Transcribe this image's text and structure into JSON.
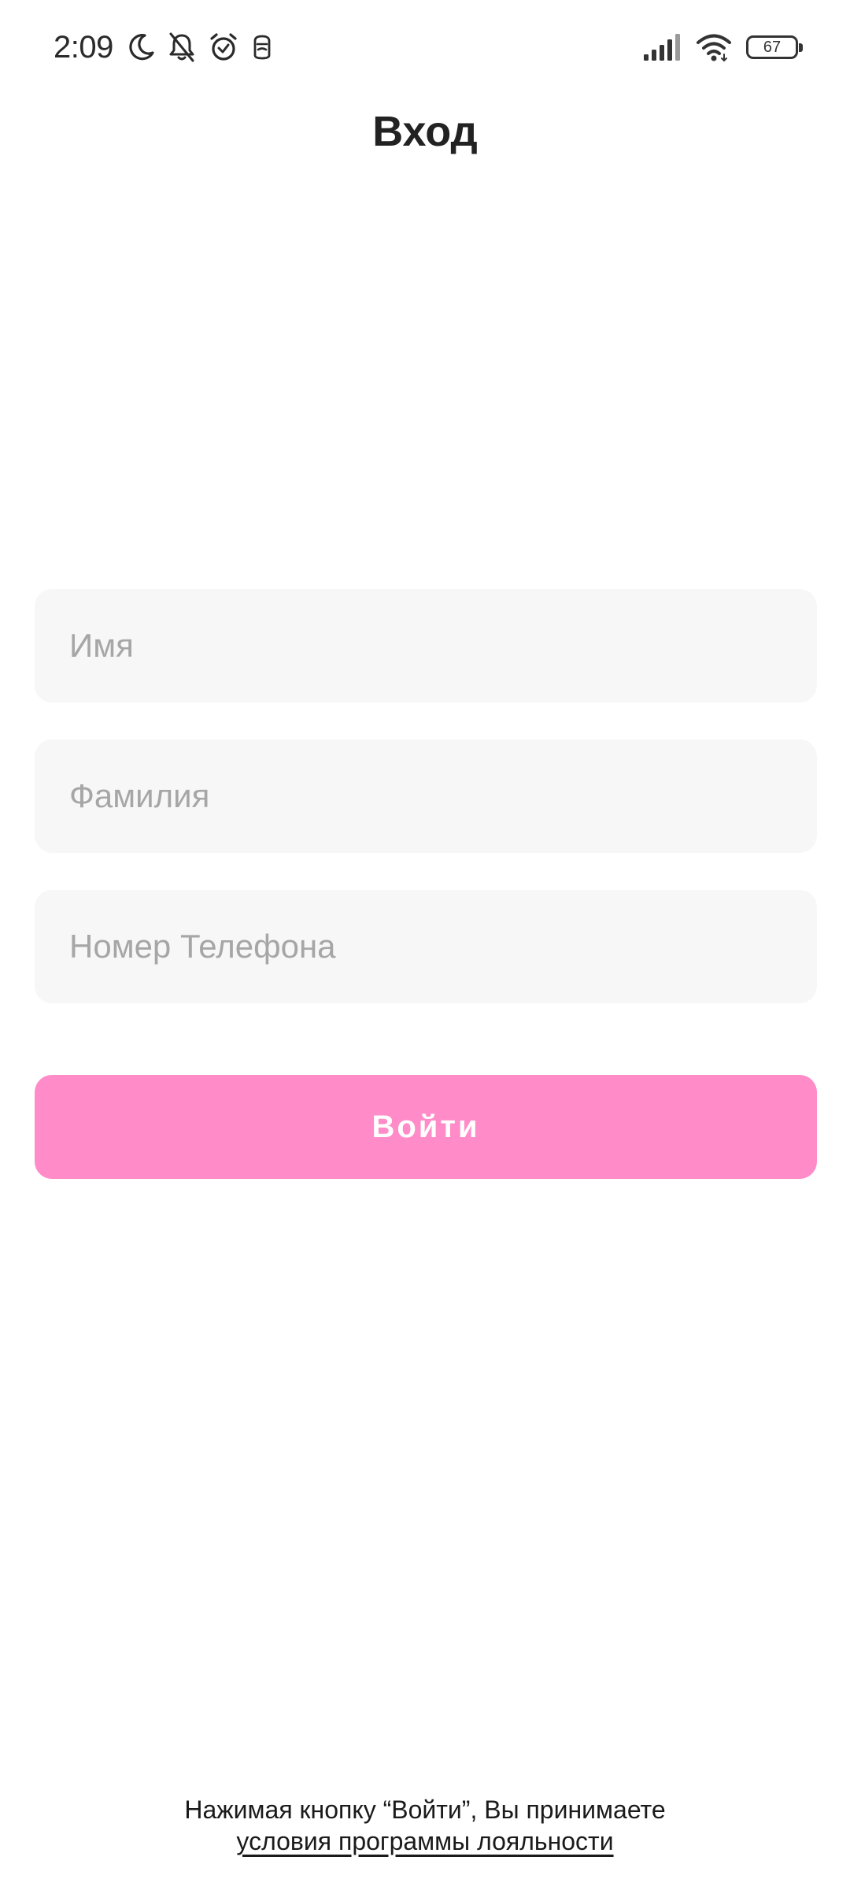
{
  "status_bar": {
    "time": "2:09",
    "icons_left": [
      "moon-icon",
      "bell-off-icon",
      "alarm-icon",
      "app-notification-icon"
    ],
    "icons_right": [
      "signal-icon",
      "wifi-icon",
      "battery-icon"
    ],
    "battery_level": "67"
  },
  "header": {
    "title": "Вход"
  },
  "form": {
    "first_name_placeholder": "Имя",
    "last_name_placeholder": "Фамилия",
    "phone_placeholder": "Номер Телефона",
    "first_name_value": "",
    "last_name_value": "",
    "phone_value": "",
    "submit_label": "Войти"
  },
  "footer": {
    "consent_text": "Нажимая кнопку “Войти”, Вы принимаете",
    "terms_link": "условия программы лояльности"
  },
  "colors": {
    "accent": "#ff8cc9",
    "field_background": "#f7f7f7",
    "placeholder": "#a6a6a6",
    "title": "#222222"
  }
}
